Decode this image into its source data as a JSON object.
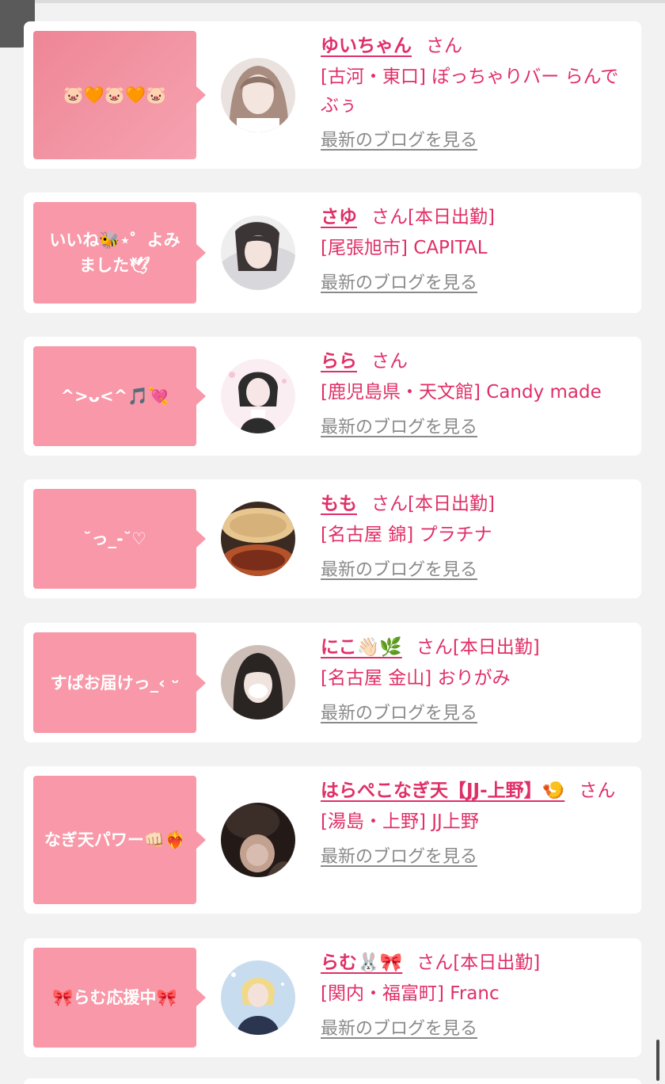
{
  "posts": [
    {
      "message": "🐷🧡🐷🧡🐷",
      "name": "ゆいちゃん",
      "honorific": "さん",
      "status": "",
      "shop": "[古河・東口] ぽっちゃりバー らんでぶぅ",
      "blog_link": "最新のブログを見る",
      "avatar_colors": [
        "#e9e2df",
        "#8f7468"
      ]
    },
    {
      "message": "いいね🐝⋆゜よみました🕊",
      "name": "さゆ",
      "honorific": "さん",
      "status": "[本日出勤]",
      "shop": "[尾張旭市] CAPITAL",
      "blog_link": "最新のブログを見る",
      "avatar_colors": [
        "#eeeeee",
        "#6a6a6a"
      ]
    },
    {
      "message": "^>ᴗ<^🎵💘",
      "name": "らら",
      "honorific": "さん",
      "status": "",
      "shop": "[鹿児島県・天文館] Candy made",
      "blog_link": "最新のブログを見る",
      "avatar_colors": [
        "#fbeef3",
        "#2c2c2c"
      ]
    },
    {
      "message": "˘っ_-˘♡",
      "name": "もも",
      "honorific": "さん",
      "status": "[本日出勤]",
      "shop": "[名古屋 錦] プラチナ",
      "blog_link": "最新のブログを見る",
      "avatar_colors": [
        "#d7b17a",
        "#7a2d18"
      ]
    },
    {
      "message": "すぱお届けっ_‹ ᵕ",
      "name": "にこ👋🏻🌿",
      "honorific": "さん",
      "status": "[本日出勤]",
      "shop": "[名古屋 金山] おりがみ",
      "blog_link": "最新のブログを見る",
      "avatar_colors": [
        "#cdbfb8",
        "#2a2422"
      ]
    },
    {
      "message": "なぎ天パワー👊🏻❤️‍🔥",
      "name": "はらぺこなぎ天【JJ-上野】🍤",
      "honorific": "さん",
      "status": "",
      "shop": "[湯島・上野] JJ上野",
      "blog_link": "最新のブログを見る",
      "avatar_colors": [
        "#c2a190",
        "#231a17"
      ]
    },
    {
      "message": "🎀らむ応援中🎀",
      "name": "らむ🐰🎀",
      "honorific": "さん",
      "status": "[本日出勤]",
      "shop": "[関内・福富町] Franc",
      "blog_link": "最新のブログを見る",
      "avatar_colors": [
        "#c8dcf0",
        "#2b3550"
      ]
    }
  ],
  "colors": {
    "accent": "#e02f68",
    "bubble": "#f898a8",
    "link_gray": "#8a8a8a",
    "background": "#f2f2f2"
  }
}
